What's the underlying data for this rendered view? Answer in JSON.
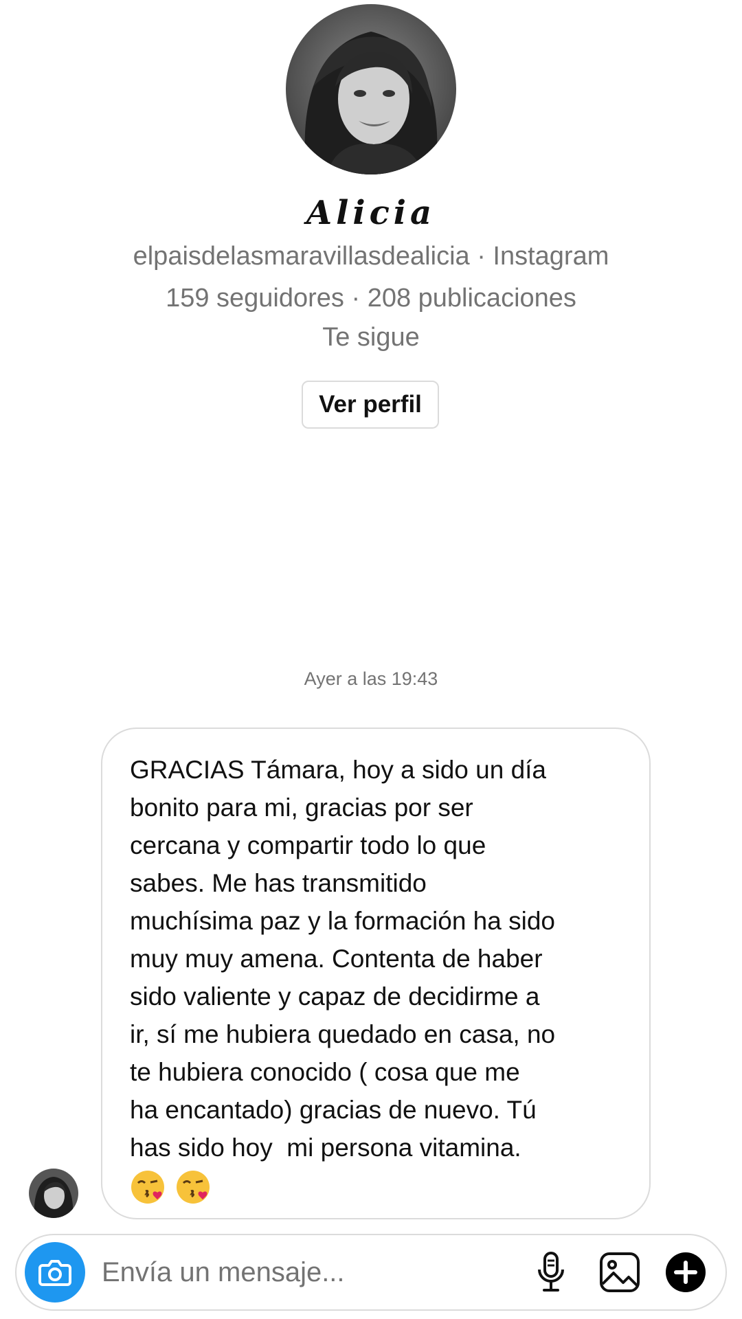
{
  "profile": {
    "display_name": "Alicia",
    "username_line": "elpaisdelasmaravillasdealicia · Instagram",
    "stats_line": "159 seguidores · 208 publicaciones",
    "follow_status": "Te sigue",
    "view_profile_label": "Ver perfil"
  },
  "thread": {
    "timestamp": "Ayer a las 19:43",
    "message_text": "GRACIAS Támara, hoy a sido un día\nbonito para mi, gracias por ser\ncercana y compartir todo lo que\nsabes. Me has transmitido\nmuchísima paz y la formación ha sido\nmuy muy amena. Contenta de haber\nsido valiente y capaz de decidirme a\nir, sí me hubiera quedado en casa, no\nte hubiera conocido ( cosa que me\nha encantado) gracias de nuevo. Tú\nhas sido hoy  mi persona vitamina.",
    "emojis": [
      "kiss-face-emoji",
      "kiss-face-emoji"
    ]
  },
  "composer": {
    "placeholder": "Envía un mensaje...",
    "icons": [
      "camera-icon",
      "microphone-icon",
      "gallery-icon",
      "plus-icon"
    ],
    "accent_color": "#1e97f0"
  }
}
